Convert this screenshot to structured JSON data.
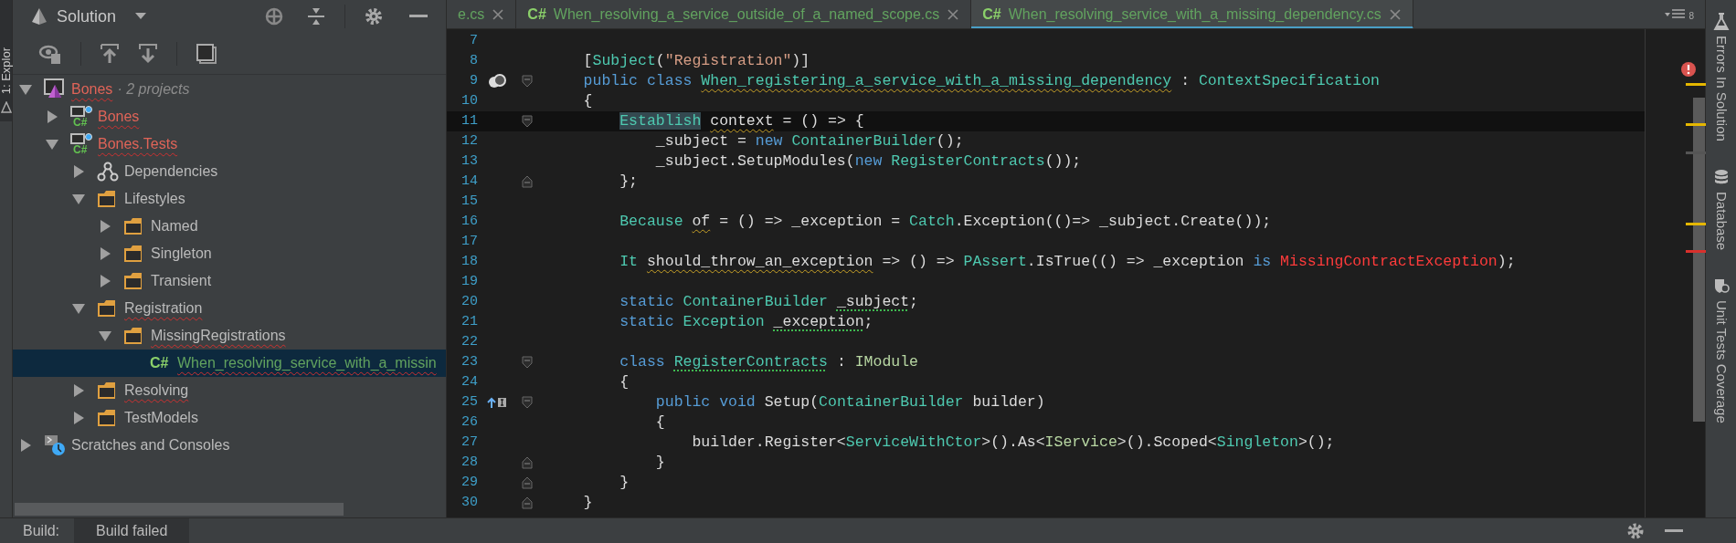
{
  "left_strip": {
    "tool_label": "1: Explor",
    "selected": true
  },
  "explorer": {
    "title": "Solution",
    "tree": [
      {
        "kind": "solution",
        "label": "Bones",
        "note": "· 2 projects",
        "expanded": true,
        "error": true,
        "selected": false,
        "children": [
          {
            "kind": "project",
            "icon_text": "C#",
            "label": "Bones",
            "expanded": false,
            "error": true,
            "selected": false
          },
          {
            "kind": "project",
            "icon_text": "C#",
            "label": "Bones.Tests",
            "expanded": true,
            "error": true,
            "selected": false,
            "children": [
              {
                "kind": "dependencies",
                "label": "Dependencies",
                "expanded": false,
                "error": false,
                "selected": false
              },
              {
                "kind": "folder",
                "label": "Lifestyles",
                "expanded": true,
                "error": false,
                "selected": false,
                "children": [
                  {
                    "kind": "folder",
                    "label": "Named",
                    "expanded": false,
                    "error": false,
                    "selected": false
                  },
                  {
                    "kind": "folder",
                    "label": "Singleton",
                    "expanded": false,
                    "error": false,
                    "selected": false
                  },
                  {
                    "kind": "folder",
                    "label": "Transient",
                    "expanded": false,
                    "error": false,
                    "selected": false
                  }
                ]
              },
              {
                "kind": "folder",
                "label": "Registration",
                "expanded": true,
                "error": true,
                "selected": false,
                "children": [
                  {
                    "kind": "folder",
                    "label": "MissingRegistrations",
                    "expanded": true,
                    "error": true,
                    "selected": false,
                    "children": [
                      {
                        "kind": "file",
                        "icon_text": "C#",
                        "label": "When_resolving_service_with_a_missin",
                        "error": true,
                        "selected": true
                      }
                    ]
                  }
                ]
              },
              {
                "kind": "folder",
                "label": "Resolving",
                "expanded": false,
                "error": true,
                "selected": false
              },
              {
                "kind": "folder",
                "label": "TestModels",
                "expanded": false,
                "error": false,
                "selected": false
              }
            ]
          }
        ]
      },
      {
        "kind": "scratches",
        "label": "Scratches and Consoles",
        "expanded": false,
        "error": false,
        "selected": false
      }
    ]
  },
  "editor": {
    "tabs": [
      {
        "label": "e.cs",
        "selected": false
      },
      {
        "label": "When_resolving_a_service_outside_of_a_named_scope.cs",
        "icon_text": "C#",
        "selected": false
      },
      {
        "label": "When_resolving_service_with_a_missing_dependency.cs",
        "icon_text": "C#",
        "selected": true
      }
    ],
    "tab_count": "8",
    "lines": [
      {
        "number": "7"
      },
      {
        "number": "8",
        "tokens": [
          {
            "text": "    [",
            "kind": "plain"
          },
          {
            "text": "Subject",
            "kind": "type"
          },
          {
            "text": "(",
            "kind": "plain"
          },
          {
            "text": "\"Registration\"",
            "kind": "string"
          },
          {
            "text": ")]",
            "kind": "plain"
          }
        ]
      },
      {
        "number": "9",
        "gutter_icon": {
          "kind": "run"
        },
        "fold_start": true,
        "tokens": [
          {
            "text": "    public class ",
            "kind": "keyword"
          },
          {
            "text": "When_registering_a_service_with_a_missing_dependency",
            "kind": "type",
            "warning": true
          },
          {
            "text": " : ",
            "kind": "plain"
          },
          {
            "text": "ContextSpecification",
            "kind": "type"
          }
        ]
      },
      {
        "number": "10",
        "tokens": [
          {
            "text": "    {",
            "kind": "plain"
          }
        ]
      },
      {
        "number": "11",
        "current": true,
        "fold_start": true,
        "tokens": [
          {
            "text": "        Establish",
            "kind": "type",
            "highlighted": true
          },
          {
            "text": " context",
            "kind": "plain",
            "warning": true
          },
          {
            "text": " = () => {",
            "kind": "plain"
          }
        ]
      },
      {
        "number": "12",
        "tokens": [
          {
            "text": "            _subject = ",
            "kind": "plain"
          },
          {
            "text": "new ",
            "kind": "keyword"
          },
          {
            "text": "ContainerBuilder",
            "kind": "type"
          },
          {
            "text": "();",
            "kind": "plain"
          }
        ]
      },
      {
        "number": "13",
        "tokens": [
          {
            "text": "            _subject.SetupModules(",
            "kind": "plain"
          },
          {
            "text": "new ",
            "kind": "keyword"
          },
          {
            "text": "RegisterContracts",
            "kind": "type"
          },
          {
            "text": "());",
            "kind": "plain"
          }
        ]
      },
      {
        "number": "14",
        "fold_end": true,
        "tokens": [
          {
            "text": "        };",
            "kind": "plain"
          }
        ]
      },
      {
        "number": "15"
      },
      {
        "number": "16",
        "tokens": [
          {
            "text": "        Because ",
            "kind": "type"
          },
          {
            "text": "of",
            "kind": "plain",
            "warning": true
          },
          {
            "text": " = () => _exception = ",
            "kind": "plain"
          },
          {
            "text": "Catch",
            "kind": "type"
          },
          {
            "text": ".Exception(()=> _subject.Create());",
            "kind": "plain"
          }
        ]
      },
      {
        "number": "17"
      },
      {
        "number": "18",
        "tokens": [
          {
            "text": "        It ",
            "kind": "type"
          },
          {
            "text": "should_throw_an_exception",
            "kind": "plain",
            "warning": true
          },
          {
            "text": " => () => ",
            "kind": "plain"
          },
          {
            "text": "PAssert",
            "kind": "type"
          },
          {
            "text": ".IsTrue(() => _exception ",
            "kind": "plain"
          },
          {
            "text": "is ",
            "kind": "keyword"
          },
          {
            "text": "MissingContractException",
            "kind": "error"
          },
          {
            "text": ");",
            "kind": "plain"
          }
        ]
      },
      {
        "number": "19"
      },
      {
        "number": "20",
        "tokens": [
          {
            "text": "        static ",
            "kind": "keyword"
          },
          {
            "text": "ContainerBuilder ",
            "kind": "type"
          },
          {
            "text": "_subject",
            "kind": "plain",
            "hint": true
          },
          {
            "text": ";",
            "kind": "plain"
          }
        ]
      },
      {
        "number": "21",
        "tokens": [
          {
            "text": "        static ",
            "kind": "keyword"
          },
          {
            "text": "Exception ",
            "kind": "type"
          },
          {
            "text": "_exception",
            "kind": "plain",
            "hint": true
          },
          {
            "text": ";",
            "kind": "plain"
          }
        ]
      },
      {
        "number": "22"
      },
      {
        "number": "23",
        "fold_start": true,
        "tokens": [
          {
            "text": "        class ",
            "kind": "keyword"
          },
          {
            "text": "RegisterContracts",
            "kind": "type",
            "hint": true
          },
          {
            "text": " : ",
            "kind": "plain"
          },
          {
            "text": "IModule",
            "kind": "interface"
          }
        ]
      },
      {
        "number": "24",
        "tokens": [
          {
            "text": "        {",
            "kind": "plain"
          }
        ]
      },
      {
        "number": "25",
        "gutter_icon": {
          "kind": "implements"
        },
        "fold_start": true,
        "tokens": [
          {
            "text": "            public void ",
            "kind": "keyword"
          },
          {
            "text": "Setup(",
            "kind": "plain"
          },
          {
            "text": "ContainerBuilder",
            "kind": "type"
          },
          {
            "text": " builder)",
            "kind": "plain"
          }
        ]
      },
      {
        "number": "26",
        "tokens": [
          {
            "text": "            {",
            "kind": "plain"
          }
        ]
      },
      {
        "number": "27",
        "tokens": [
          {
            "text": "                builder.Register<",
            "kind": "plain"
          },
          {
            "text": "ServiceWithCtor",
            "kind": "type"
          },
          {
            "text": ">().As<",
            "kind": "plain"
          },
          {
            "text": "IService",
            "kind": "interface"
          },
          {
            "text": ">().Scoped<",
            "kind": "plain"
          },
          {
            "text": "Singleton",
            "kind": "type"
          },
          {
            "text": ">();",
            "kind": "plain"
          }
        ]
      },
      {
        "number": "28",
        "fold_end": true,
        "tokens": [
          {
            "text": "            }",
            "kind": "plain"
          }
        ]
      },
      {
        "number": "29",
        "fold_end": true,
        "tokens": [
          {
            "text": "        }",
            "kind": "plain"
          }
        ]
      },
      {
        "number": "30",
        "fold_end": true,
        "tokens": [
          {
            "text": "    }",
            "kind": "plain"
          }
        ]
      }
    ]
  },
  "right_strip": [
    {
      "kind": "errors",
      "label": "Errors In Solution"
    },
    {
      "kind": "database",
      "label": "Database"
    },
    {
      "kind": "coverage",
      "label": "Unit Tests Coverage"
    }
  ],
  "status_bar": {
    "label": "Build:",
    "tabs": [
      {
        "label": "Build failed",
        "selected": true
      }
    ]
  }
}
